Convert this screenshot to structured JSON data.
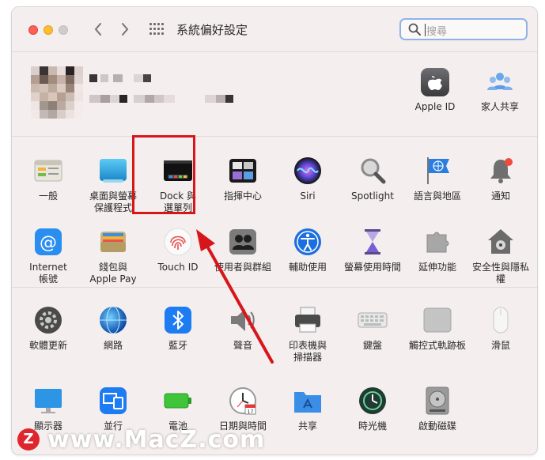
{
  "window": {
    "title": "系統偏好設定",
    "search_placeholder": "搜尋"
  },
  "top_items": [
    {
      "label": "Apple ID",
      "icon": "apple-id-icon"
    },
    {
      "label": "家人共享",
      "icon": "family-sharing-icon"
    }
  ],
  "row1": [
    {
      "label": "一般",
      "icon": "general-icon"
    },
    {
      "label": "桌面與螢幕\n保護程式",
      "icon": "desktop-screensaver-icon"
    },
    {
      "label": "Dock 與\n選單列",
      "icon": "dock-menubar-icon"
    },
    {
      "label": "指揮中心",
      "icon": "mission-control-icon"
    },
    {
      "label": "Siri",
      "icon": "siri-icon"
    },
    {
      "label": "Spotlight",
      "icon": "spotlight-icon"
    },
    {
      "label": "語言與地區",
      "icon": "language-region-icon"
    },
    {
      "label": "通知",
      "icon": "notifications-icon"
    }
  ],
  "row2": [
    {
      "label": "Internet\n帳號",
      "icon": "internet-accounts-icon"
    },
    {
      "label": "錢包與\nApple Pay",
      "icon": "wallet-icon"
    },
    {
      "label": "Touch ID",
      "icon": "touch-id-icon"
    },
    {
      "label": "使用者與群組",
      "icon": "users-groups-icon"
    },
    {
      "label": "輔助使用",
      "icon": "accessibility-icon"
    },
    {
      "label": "螢幕使用時間",
      "icon": "screen-time-icon"
    },
    {
      "label": "延伸功能",
      "icon": "extensions-icon"
    },
    {
      "label": "安全性與隱私權",
      "icon": "security-privacy-icon"
    }
  ],
  "row3": [
    {
      "label": "軟體更新",
      "icon": "software-update-icon"
    },
    {
      "label": "網路",
      "icon": "network-icon"
    },
    {
      "label": "藍牙",
      "icon": "bluetooth-icon"
    },
    {
      "label": "聲音",
      "icon": "sound-icon"
    },
    {
      "label": "印表機與\n掃描器",
      "icon": "printers-scanners-icon"
    },
    {
      "label": "鍵盤",
      "icon": "keyboard-icon"
    },
    {
      "label": "觸控式軌跡板",
      "icon": "trackpad-icon"
    },
    {
      "label": "滑鼠",
      "icon": "mouse-icon"
    }
  ],
  "row4": [
    {
      "label": "顯示器",
      "icon": "displays-icon"
    },
    {
      "label": "並行",
      "icon": "sidecar-icon"
    },
    {
      "label": "電池",
      "icon": "battery-icon"
    },
    {
      "label": "日期與時間",
      "icon": "date-time-icon"
    },
    {
      "label": "共享",
      "icon": "sharing-icon"
    },
    {
      "label": "時光機",
      "icon": "time-machine-icon"
    },
    {
      "label": "啟動磁碟",
      "icon": "startup-disk-icon"
    }
  ],
  "watermark": {
    "badge": "Z",
    "text": "www.MacZ.com"
  },
  "colors": {
    "highlight": "#d7161c",
    "arrow": "#d7161c",
    "search_focus": "#8fb3e8"
  }
}
